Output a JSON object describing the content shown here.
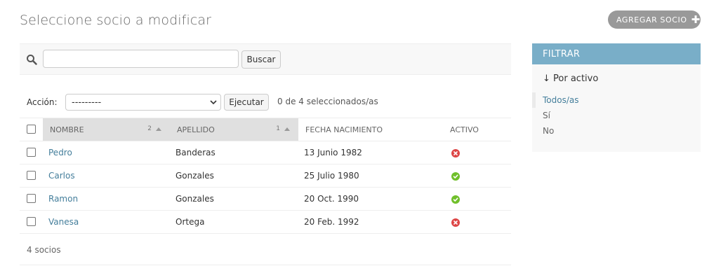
{
  "page_title": "Seleccione socio a modificar",
  "add_button": {
    "label": "AGREGAR SOCIO"
  },
  "search": {
    "value": "",
    "placeholder": "",
    "button_label": "Buscar"
  },
  "actions": {
    "label": "Acción:",
    "selected_option": "---------",
    "button_label": "Ejecutar",
    "selection_count": "0 de 4 seleccionados/as"
  },
  "table": {
    "columns": [
      {
        "label": "NOMBRE",
        "sort_priority": "2"
      },
      {
        "label": "APELLIDO",
        "sort_priority": "1"
      },
      {
        "label": "FECHA NACIMIENTO"
      },
      {
        "label": "ACTIVO"
      }
    ],
    "rows": [
      {
        "nombre": "Pedro",
        "apellido": "Banderas",
        "fecha": "13 Junio 1982",
        "activo": "no"
      },
      {
        "nombre": "Carlos",
        "apellido": "Gonzales",
        "fecha": "25 Julio 1980",
        "activo": "yes"
      },
      {
        "nombre": "Ramon",
        "apellido": "Gonzales",
        "fecha": "20 Oct. 1990",
        "activo": "yes"
      },
      {
        "nombre": "Vanesa",
        "apellido": "Ortega",
        "fecha": "20 Feb. 1992",
        "activo": "no"
      }
    ]
  },
  "paginator": {
    "text": "4 socios"
  },
  "filter": {
    "title": "FILTRAR",
    "by_label": "↓ Por activo",
    "options": [
      {
        "label": "Todos/as",
        "selected": true
      },
      {
        "label": "Sí",
        "selected": false
      },
      {
        "label": "No",
        "selected": false
      }
    ]
  },
  "colors": {
    "link": "#447e9b",
    "filter_header": "#79aec8",
    "active_yes": "#70bf2b",
    "active_no": "#dd4646"
  },
  "icons": {
    "search": "magnifier-icon",
    "add": "plus-icon",
    "active_yes": "check-circle-icon",
    "active_no": "cross-circle-icon"
  }
}
